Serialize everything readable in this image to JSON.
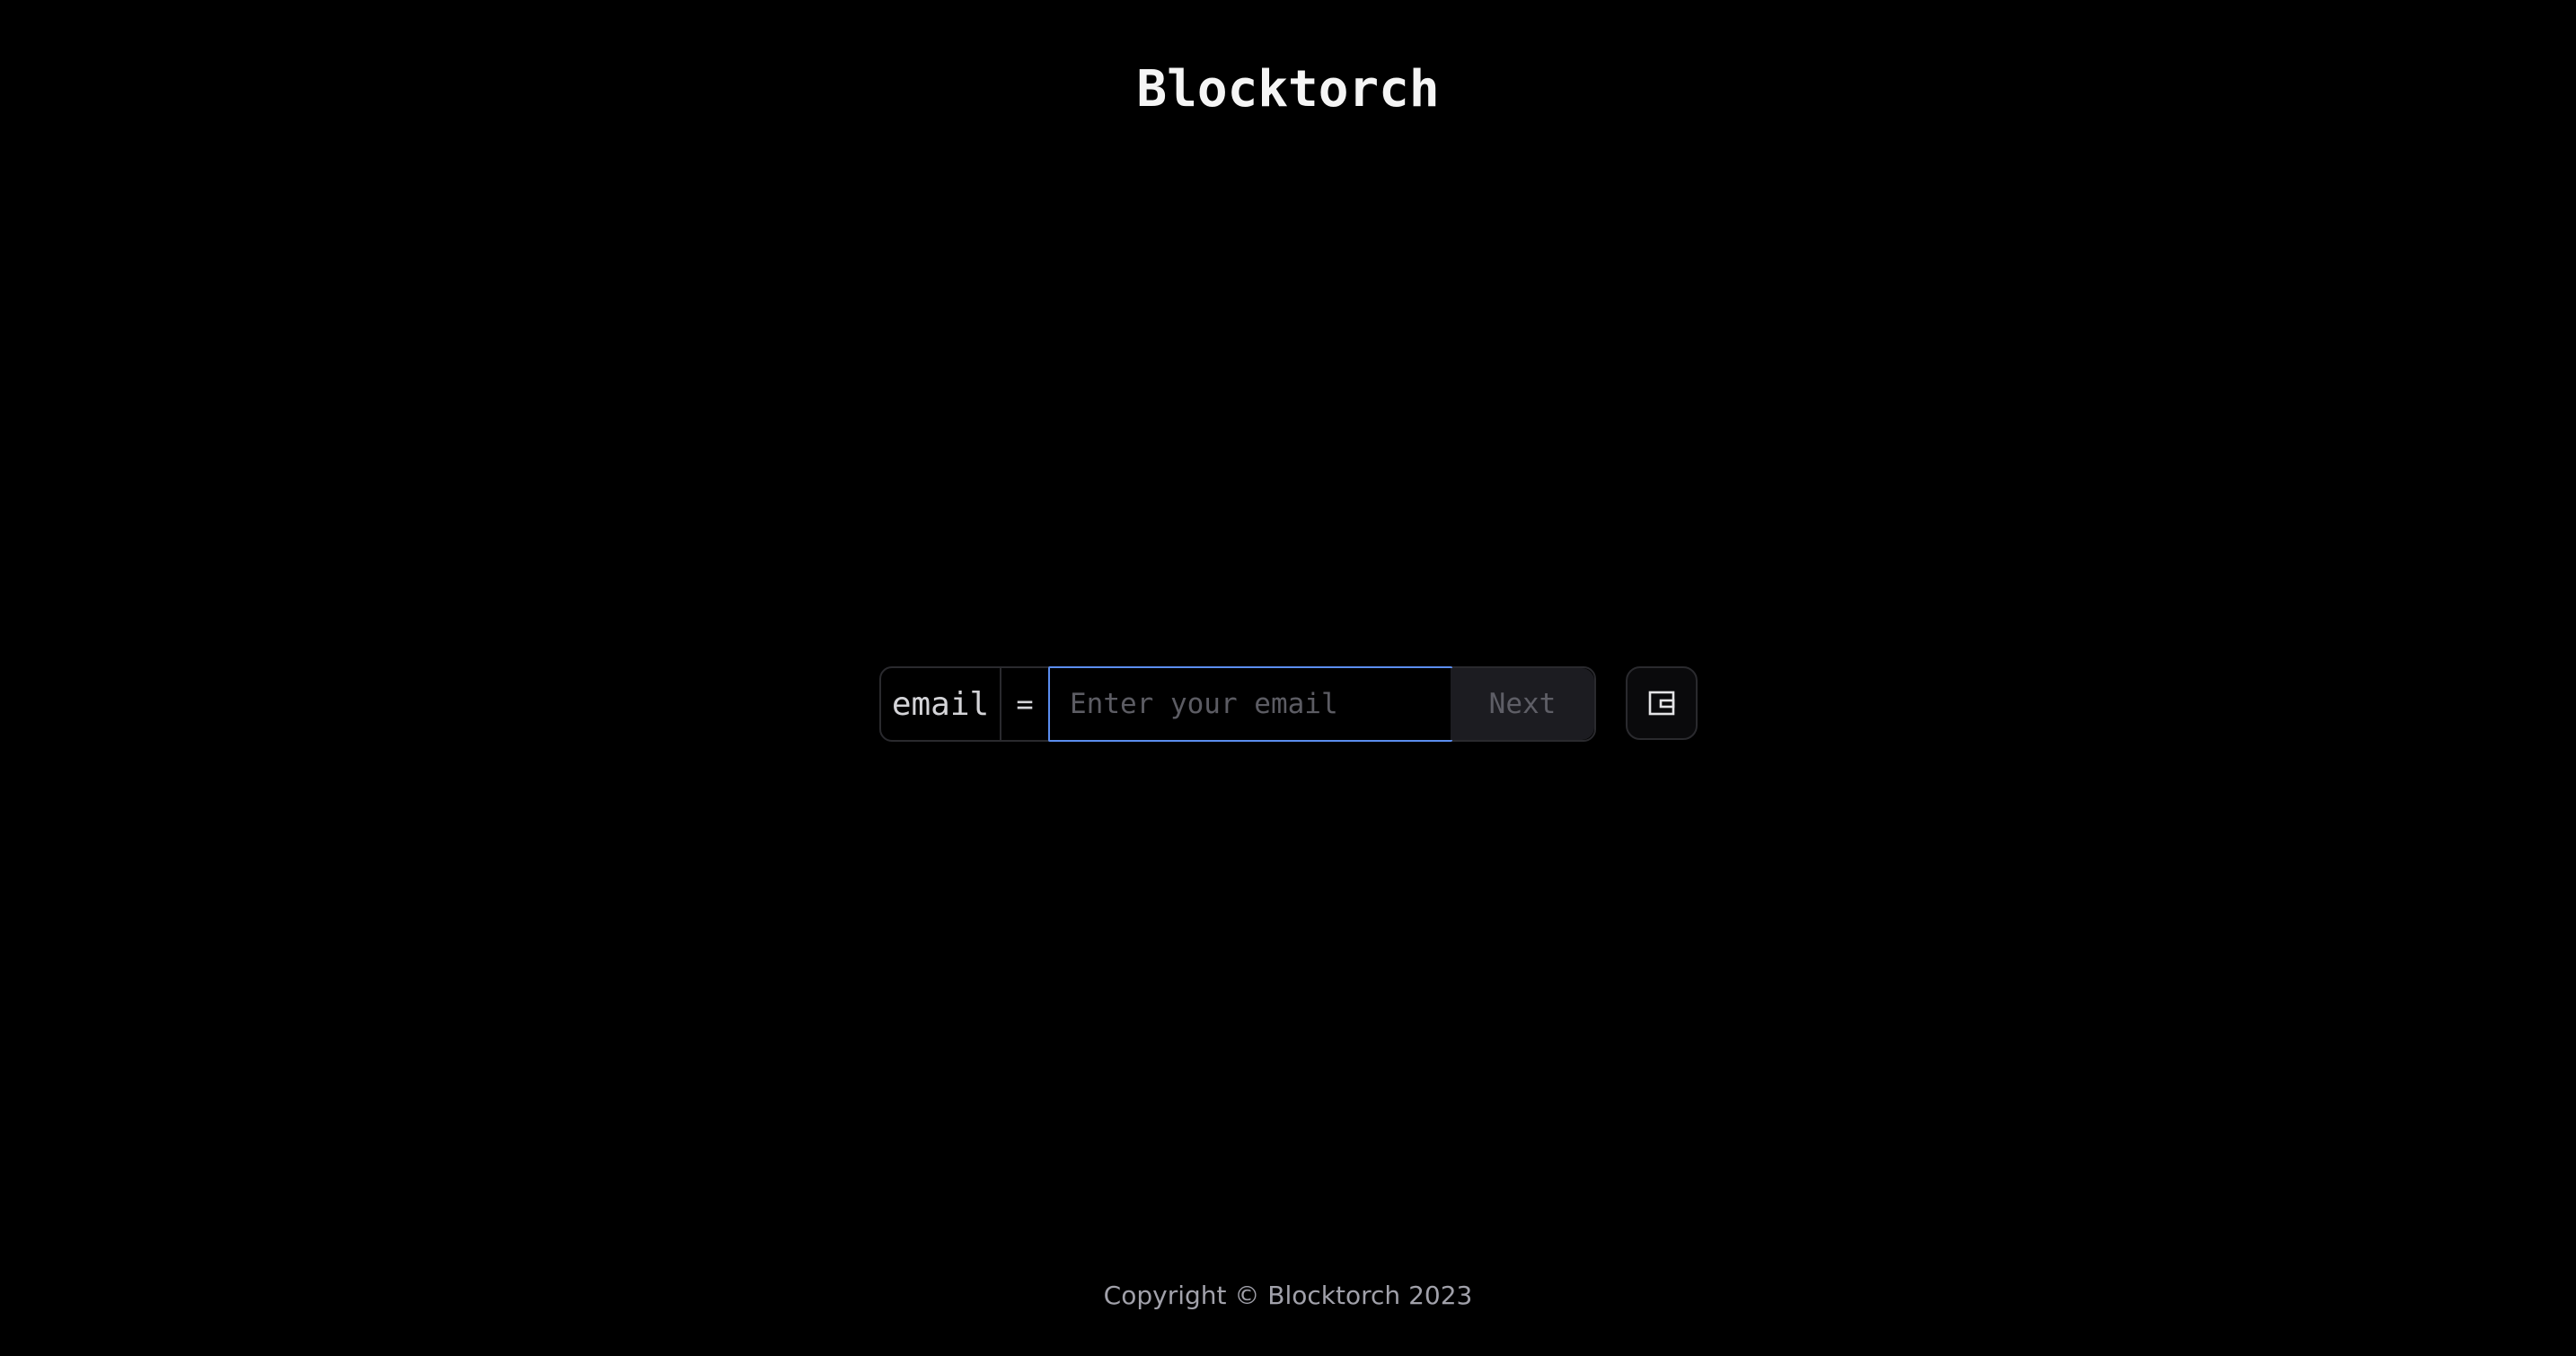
{
  "header": {
    "brand": "Blocktorch"
  },
  "login_form": {
    "field_key": "email",
    "operator": "=",
    "email_input": {
      "value": "",
      "placeholder": "Enter your email",
      "focus_color": "#5b8def"
    },
    "next_label": "Next"
  },
  "wallet_button": {
    "icon": "wallet-icon"
  },
  "footer": {
    "copyright": "Copyright © Blocktorch 2023"
  }
}
